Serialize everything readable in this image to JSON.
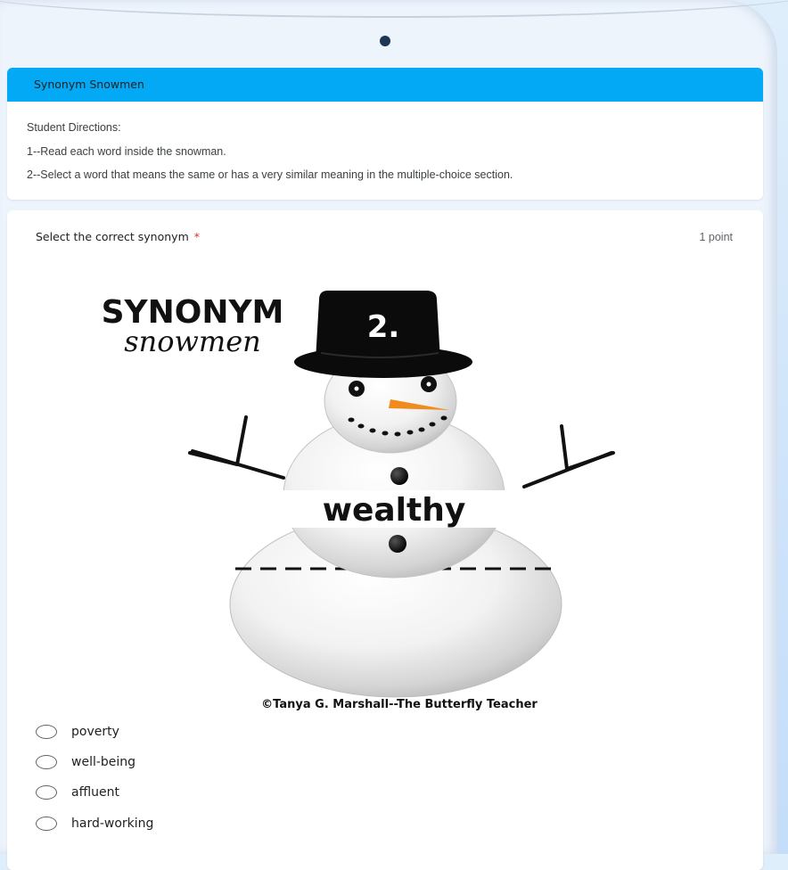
{
  "form": {
    "title": "Synonym Snowmen",
    "directions": [
      "Student Directions:",
      "1--Read each word inside the snowman.",
      "2--Select a word that means the same or has a very similar meaning in the multiple-choice section."
    ]
  },
  "question": {
    "title": "Select the correct synonym",
    "required_mark": "*",
    "points": "1 point",
    "image": {
      "heading": "SYNONYM",
      "subheading": "snowmen",
      "hat_number": "2.",
      "word": "wealthy",
      "credit": "©Tanya G. Marshall--The Butterfly Teacher"
    },
    "options": [
      "poverty",
      "well-being",
      "affluent",
      "hard-working"
    ],
    "selected": null
  },
  "colors": {
    "accent": "#03a9f4",
    "required": "#d93025",
    "carrot": "#f08c1e"
  }
}
